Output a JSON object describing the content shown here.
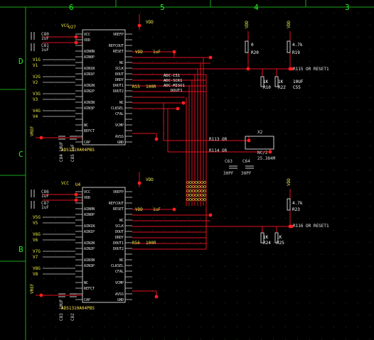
{
  "border": {
    "columns": [
      "6",
      "5",
      "4",
      "3"
    ],
    "rows": [
      "D",
      "C",
      "B"
    ]
  },
  "chips": [
    {
      "ref": "U27",
      "part": "ADS1310A04PBS",
      "vcc": "VCC",
      "vdd_pin": "VDD",
      "left_pins": [
        "VCC",
        "VDD",
        "",
        "AIN0N",
        "AIN0P",
        "",
        "AIN1N",
        "AIN1P",
        "",
        "AIN2N",
        "AIN2P",
        "",
        "AIN3N",
        "AIN3P",
        "",
        "",
        "NC",
        "REFCT",
        "",
        "CAP"
      ],
      "right_pins": [
        "VREFP",
        "",
        "REFCOUT",
        "RESET",
        "",
        "NC",
        "SCLK",
        "DOUT",
        "DRDY",
        "DOUT1",
        "DOUT2",
        "",
        "NC",
        "CLKSEL",
        "CFAL",
        "",
        "VCMP",
        "",
        "AVSS",
        "GND"
      ]
    },
    {
      "ref": "U4",
      "part": "ADS1310A04PBS",
      "vcc": "VCC",
      "vdd_pin": "VDD",
      "left_pins": [
        "VCC",
        "VDD",
        "",
        "AIN0N",
        "AIN0P",
        "",
        "AIN1N",
        "AIN1P",
        "",
        "AIN2N",
        "AIN2P",
        "",
        "AIN3N",
        "AIN3P",
        "",
        "",
        "NC",
        "REFCT",
        "",
        "CAP"
      ],
      "right_pins": [
        "VREFP",
        "",
        "REFCOUT",
        "RESET",
        "",
        "NC",
        "SCLK",
        "DOUT",
        "DRDY",
        "DOUT1",
        "DOUT2",
        "",
        "NC",
        "CLKSEL",
        "CFAL",
        "",
        "VCMP",
        "",
        "AVSS",
        "GND"
      ]
    }
  ],
  "inputs_top": [
    "V1G",
    "V1",
    "V2G",
    "V2",
    "V3G",
    "V3",
    "V4G",
    "V4"
  ],
  "inputs_bottom": [
    "V5G",
    "V5",
    "V6G",
    "V6",
    "V7G",
    "V7",
    "V8G",
    "V8"
  ],
  "caps_top": [
    {
      "ref": "C80",
      "value": "1uF"
    },
    {
      "ref": "C81",
      "value": "1uF"
    },
    {
      "ref": "C84",
      "value": "10UF"
    },
    {
      "ref": "C85",
      "value": "1uF"
    }
  ],
  "caps_bottom": [
    {
      "ref": "C86",
      "value": "1uF"
    },
    {
      "ref": "C87",
      "value": "1uF"
    },
    {
      "ref": "C83",
      "value": "10UF"
    },
    {
      "ref": "C82",
      "value": "1uF"
    }
  ],
  "vref_label": "VREF",
  "vdd_label": "VDD",
  "resistors": [
    {
      "ref": "R20",
      "value": "0"
    },
    {
      "ref": "R19",
      "value": "4.7k"
    },
    {
      "ref": "R10",
      "value": "1K"
    },
    {
      "ref": "R22",
      "value": "1K"
    },
    {
      "ref": "R23",
      "value": "4.7k"
    },
    {
      "ref": "R24",
      "value": "1K"
    },
    {
      "ref": "R25",
      "value": "1K"
    },
    {
      "ref": "R55",
      "value": "100R"
    },
    {
      "ref": "R56",
      "value": "100R"
    }
  ],
  "nets": [
    "R115 OR RESET1",
    "ADC-CS1",
    "ADC-SCK1",
    "ADC-MISO1",
    "DOUT1",
    "R113 OR",
    "R114 OR",
    "R116 OR RESET1"
  ],
  "cap_labels": [
    "C55",
    "C63",
    "C64",
    "10UF"
  ],
  "vdd_cap_labels": [
    "1uF",
    "1uF",
    "1uF",
    "1uF"
  ],
  "crystal": {
    "ref": "X2",
    "label": "NC/2",
    "freq": "25.384M"
  },
  "load_caps": [
    "30PF",
    "30PF"
  ]
}
